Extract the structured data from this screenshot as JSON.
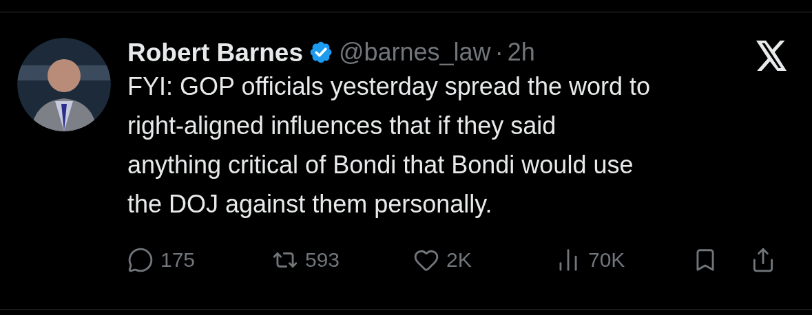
{
  "author": {
    "name": "Robert Barnes",
    "verified": true,
    "handle": "@barnes_law",
    "separator": "·",
    "time": "2h"
  },
  "text_lines": [
    "FYI: GOP officials yesterday spread the word to",
    "right-aligned influences that if they said",
    "anything critical of Bondi that Bondi would use",
    "the DOJ against them personally."
  ],
  "actions": [
    {
      "kind": "reply",
      "count": "175"
    },
    {
      "kind": "repost",
      "count": "593"
    },
    {
      "kind": "like",
      "count": "2K"
    },
    {
      "kind": "views",
      "count": "70K"
    },
    {
      "kind": "bookmark"
    },
    {
      "kind": "share"
    }
  ]
}
